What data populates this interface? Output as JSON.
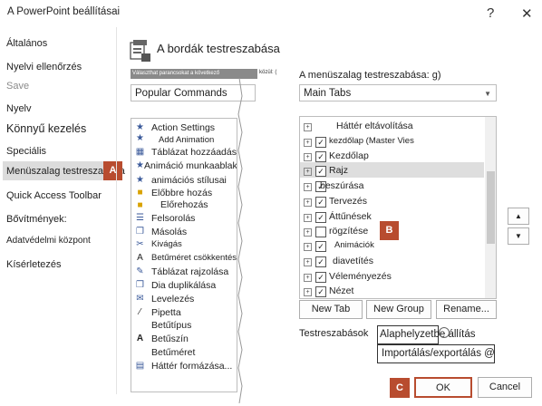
{
  "window": {
    "title": "A PowerPoint beállításai",
    "help": "?",
    "close": "✕"
  },
  "nav": [
    "Általános",
    "Nyelvi ellenőrzés",
    "Save",
    "Nyelv",
    "Könnyű kezelés",
    "Speciális",
    "Menüszalag testreszabása",
    "Quick Access Toolbar",
    "Bővítmények:",
    "Adatvédelmi központ",
    "Kísérletezés"
  ],
  "header": "A bordák testreszabása",
  "left_hint": "Választhat parancsokat a következő",
  "left_hint_tail": "közül: (",
  "right_label": "A menüszalag testreszabása: g)",
  "left_select": "Popular Commands",
  "right_select": "Main Tabs",
  "commands": [
    "Action Settings",
    "Add Animation",
    "Táblázat hozzáadása",
    "Animáció munkaablak",
    "animációs stílusai",
    "Előbbre hozás",
    "Előrehozás",
    "Felsorolás",
    "Másolás",
    "Kivágás",
    "Betűméret csökkentése",
    "Táblázat rajzolása",
    "Dia duplikálása",
    "Levelezés",
    "Pipetta",
    "Betűtípus",
    "Betűszín",
    "Betűméret",
    "Háttér formázása..."
  ],
  "tabs": [
    {
      "label": "Háttér eltávolítása",
      "checked": false
    },
    {
      "label": "kezdőlap (Master Vies",
      "checked": true
    },
    {
      "label": "Kezdőlap",
      "checked": true
    },
    {
      "label": "Rajz",
      "checked": true
    },
    {
      "label": "beszúrása",
      "checked": true
    },
    {
      "label": "Tervezés",
      "checked": true
    },
    {
      "label": "Áttűnések",
      "checked": true
    },
    {
      "label": "rögzítése",
      "checked": false
    },
    {
      "label": "Animációk",
      "checked": true
    },
    {
      "label": "diavetítés",
      "checked": true
    },
    {
      "label": "Véleményezés",
      "checked": true
    },
    {
      "label": "Nézet",
      "checked": true
    }
  ],
  "buttons": {
    "new_tab": "New Tab",
    "new_group": "New Group",
    "rename": "Rename...",
    "customizations_label": "Testreszabások",
    "reset": "Alaphelyzetbe állítás",
    "import_export": "Importálás/exportálás @",
    "ok": "OK",
    "cancel": "Cancel",
    "up": "▲",
    "down": "▼"
  },
  "callouts": {
    "a": "A",
    "b": "B",
    "c": "C"
  },
  "colors": {
    "callout": "#b84c2f",
    "ok_border": "#0078d7"
  },
  "icons": [
    "question-icon",
    "close-icon",
    "ribbon-icon",
    "expand-icon",
    "checkbox-icon",
    "arrow-up-icon",
    "arrow-down-icon"
  ]
}
